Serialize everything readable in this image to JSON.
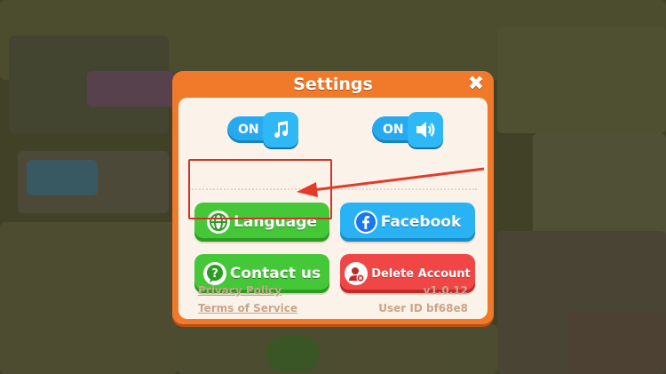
{
  "dialog": {
    "title": "Settings",
    "close_glyph": "✖",
    "music_toggle": {
      "state_label": "ON",
      "icon": "music-note-icon"
    },
    "sound_toggle": {
      "state_label": "ON",
      "icon": "speaker-icon"
    },
    "buttons": {
      "language": {
        "label": "Language",
        "icon": "globe-icon",
        "color": "#44c838"
      },
      "facebook": {
        "label": "Facebook",
        "icon": "facebook-icon",
        "color": "#29b3f4"
      },
      "contact": {
        "label": "Contact us",
        "icon": "question-bubble-icon",
        "color": "#44c838"
      },
      "delete": {
        "label": "Delete Account",
        "icon": "delete-account-icon",
        "color": "#f04646"
      }
    },
    "footer": {
      "privacy_policy": "Privacy Policy",
      "terms_of_service": "Terms of Service",
      "version": "v1.0.12",
      "user_id": "User ID bf68e8"
    },
    "colors": {
      "frame": "#f07a2a",
      "panel": "#fbf3ea",
      "toggle": "#27a9f0"
    }
  },
  "annotation": {
    "highlight_target": "language-button",
    "highlight_color": "#d2322a"
  }
}
